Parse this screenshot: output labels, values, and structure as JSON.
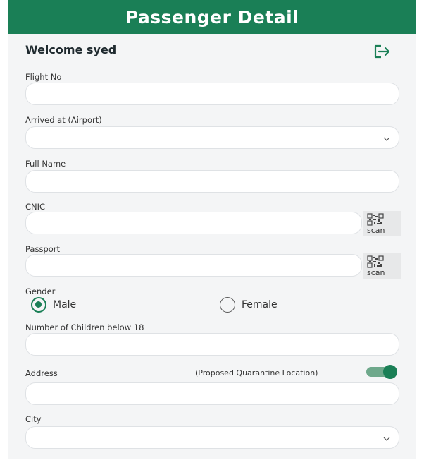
{
  "header": {
    "title": "Passenger Detail"
  },
  "welcome": "Welcome syed",
  "labels": {
    "flight_no": "Flight No",
    "arrived_at": "Arrived at (Airport)",
    "full_name": "Full Name",
    "cnic": "CNIC",
    "passport": "Passport",
    "gender": "Gender",
    "children": "Number of Children below 18",
    "address": "Address",
    "quarantine": "(Proposed Quarantine Location)",
    "city": "City"
  },
  "scan_label": "scan",
  "gender": {
    "options": [
      "Male",
      "Female"
    ],
    "selected": "Male"
  },
  "toggle": {
    "quarantine_on": true
  },
  "colors": {
    "primary": "#1a7f56",
    "toggle_track": "#6ea88b"
  },
  "icons": {
    "logout": "logout-icon",
    "dropdown": "chevron-down-icon",
    "scan": "qr-code-icon"
  }
}
